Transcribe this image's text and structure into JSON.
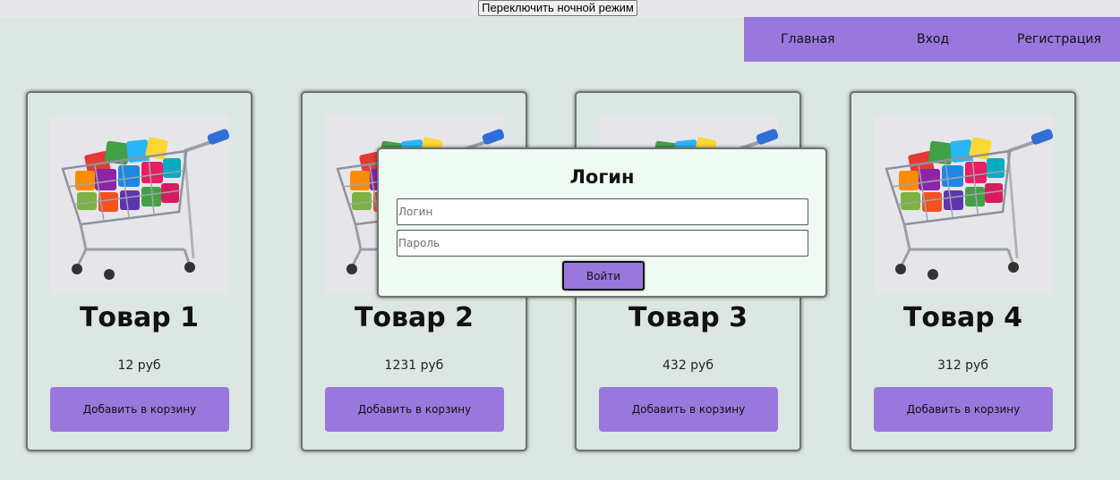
{
  "toolbar": {
    "night_mode_label": "Переключить ночной режим"
  },
  "nav": {
    "items": [
      {
        "label": "Главная"
      },
      {
        "label": "Вход"
      },
      {
        "label": "Регистрация"
      }
    ]
  },
  "products": [
    {
      "title": "Товар 1",
      "price": "12 руб",
      "add_label": "Добавить в корзину"
    },
    {
      "title": "Товар 2",
      "price": "1231 руб",
      "add_label": "Добавить в корзину"
    },
    {
      "title": "Товар 3",
      "price": "432 руб",
      "add_label": "Добавить в корзину"
    },
    {
      "title": "Товар 4",
      "price": "312 руб",
      "add_label": "Добавить в корзину"
    }
  ],
  "login_modal": {
    "title": "Логин",
    "login_placeholder": "Логин",
    "password_placeholder": "Пароль",
    "submit_label": "Войти"
  },
  "colors": {
    "page_background": "#dce6e2",
    "accent": "#9878dc",
    "modal_background": "#effaf3"
  },
  "icons": {
    "product_image": "shopping-cart-icon"
  }
}
